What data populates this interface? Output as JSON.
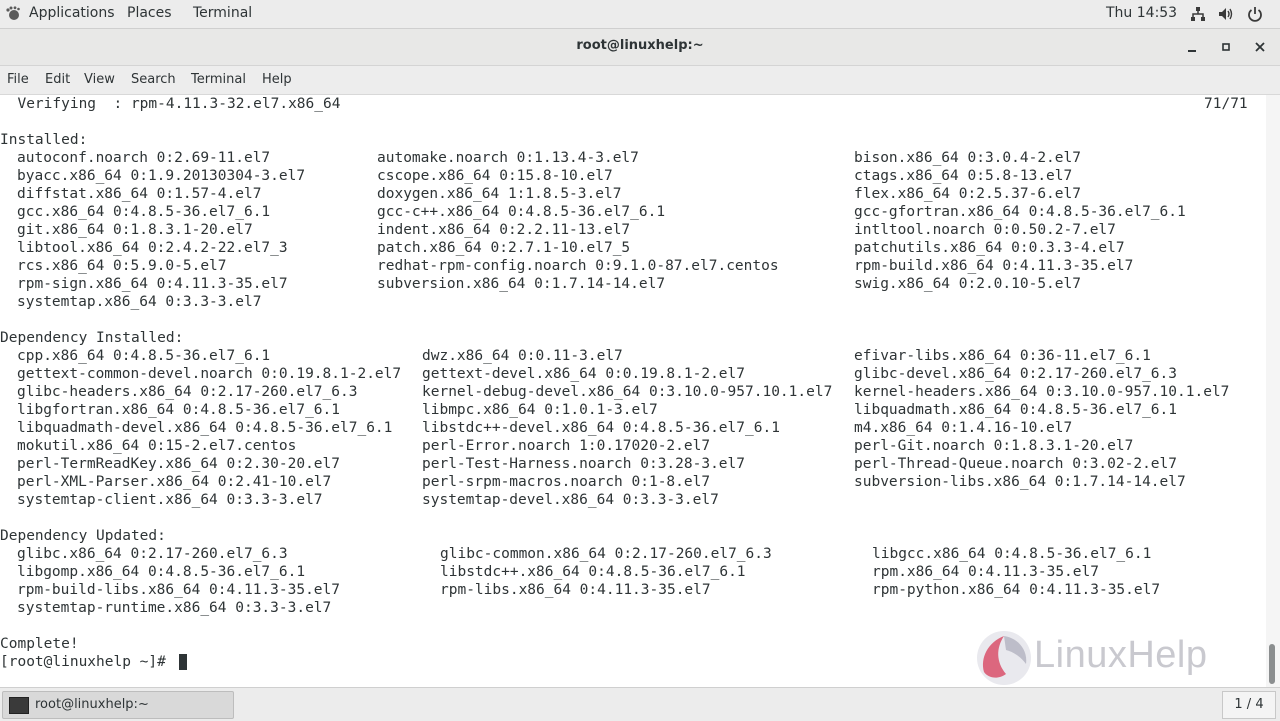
{
  "topbar": {
    "applications": "Applications",
    "places": "Places",
    "terminal": "Terminal",
    "clock": "Thu 14:53"
  },
  "window": {
    "title": "root@linuxhelp:~"
  },
  "menu": [
    "File",
    "Edit",
    "View",
    "Search",
    "Terminal",
    "Help"
  ],
  "terminal": {
    "verifying": "  Verifying  : rpm-4.11.3-32.el7.x86_64",
    "progress": "71/71",
    "installed_header": "Installed:",
    "installed": [
      [
        "autoconf.noarch 0:2.69-11.el7",
        "automake.noarch 0:1.13.4-3.el7",
        "bison.x86_64 0:3.0.4-2.el7"
      ],
      [
        "byacc.x86_64 0:1.9.20130304-3.el7",
        "cscope.x86_64 0:15.8-10.el7",
        "ctags.x86_64 0:5.8-13.el7"
      ],
      [
        "diffstat.x86_64 0:1.57-4.el7",
        "doxygen.x86_64 1:1.8.5-3.el7",
        "flex.x86_64 0:2.5.37-6.el7"
      ],
      [
        "gcc.x86_64 0:4.8.5-36.el7_6.1",
        "gcc-c++.x86_64 0:4.8.5-36.el7_6.1",
        "gcc-gfortran.x86_64 0:4.8.5-36.el7_6.1"
      ],
      [
        "git.x86_64 0:1.8.3.1-20.el7",
        "indent.x86_64 0:2.2.11-13.el7",
        "intltool.noarch 0:0.50.2-7.el7"
      ],
      [
        "libtool.x86_64 0:2.4.2-22.el7_3",
        "patch.x86_64 0:2.7.1-10.el7_5",
        "patchutils.x86_64 0:0.3.3-4.el7"
      ],
      [
        "rcs.x86_64 0:5.9.0-5.el7",
        "redhat-rpm-config.noarch 0:9.1.0-87.el7.centos",
        "rpm-build.x86_64 0:4.11.3-35.el7"
      ],
      [
        "rpm-sign.x86_64 0:4.11.3-35.el7",
        "subversion.x86_64 0:1.7.14-14.el7",
        "swig.x86_64 0:2.0.10-5.el7"
      ],
      [
        "systemtap.x86_64 0:3.3-3.el7",
        "",
        ""
      ]
    ],
    "dep_installed_header": "Dependency Installed:",
    "dep_installed": [
      [
        "cpp.x86_64 0:4.8.5-36.el7_6.1",
        "dwz.x86_64 0:0.11-3.el7",
        "efivar-libs.x86_64 0:36-11.el7_6.1"
      ],
      [
        "gettext-common-devel.noarch 0:0.19.8.1-2.el7",
        "gettext-devel.x86_64 0:0.19.8.1-2.el7",
        "glibc-devel.x86_64 0:2.17-260.el7_6.3"
      ],
      [
        "glibc-headers.x86_64 0:2.17-260.el7_6.3",
        "kernel-debug-devel.x86_64 0:3.10.0-957.10.1.el7",
        "kernel-headers.x86_64 0:3.10.0-957.10.1.el7"
      ],
      [
        "libgfortran.x86_64 0:4.8.5-36.el7_6.1",
        "libmpc.x86_64 0:1.0.1-3.el7",
        "libquadmath.x86_64 0:4.8.5-36.el7_6.1"
      ],
      [
        "libquadmath-devel.x86_64 0:4.8.5-36.el7_6.1",
        "libstdc++-devel.x86_64 0:4.8.5-36.el7_6.1",
        "m4.x86_64 0:1.4.16-10.el7"
      ],
      [
        "mokutil.x86_64 0:15-2.el7.centos",
        "perl-Error.noarch 1:0.17020-2.el7",
        "perl-Git.noarch 0:1.8.3.1-20.el7"
      ],
      [
        "perl-TermReadKey.x86_64 0:2.30-20.el7",
        "perl-Test-Harness.noarch 0:3.28-3.el7",
        "perl-Thread-Queue.noarch 0:3.02-2.el7"
      ],
      [
        "perl-XML-Parser.x86_64 0:2.41-10.el7",
        "perl-srpm-macros.noarch 0:1-8.el7",
        "subversion-libs.x86_64 0:1.7.14-14.el7"
      ],
      [
        "systemtap-client.x86_64 0:3.3-3.el7",
        "systemtap-devel.x86_64 0:3.3-3.el7",
        ""
      ]
    ],
    "dep_updated_header": "Dependency Updated:",
    "dep_updated": [
      [
        "glibc.x86_64 0:2.17-260.el7_6.3",
        "glibc-common.x86_64 0:2.17-260.el7_6.3",
        "libgcc.x86_64 0:4.8.5-36.el7_6.1"
      ],
      [
        "libgomp.x86_64 0:4.8.5-36.el7_6.1",
        "libstdc++.x86_64 0:4.8.5-36.el7_6.1",
        "rpm.x86_64 0:4.11.3-35.el7"
      ],
      [
        "rpm-build-libs.x86_64 0:4.11.3-35.el7",
        "rpm-libs.x86_64 0:4.11.3-35.el7",
        "rpm-python.x86_64 0:4.11.3-35.el7"
      ],
      [
        "systemtap-runtime.x86_64 0:3.3-3.el7",
        "",
        ""
      ]
    ],
    "complete": "Complete!",
    "prompt": "[root@linuxhelp ~]# "
  },
  "watermark": {
    "text": "LinuxHelp"
  },
  "taskbar": {
    "item_label": "root@linuxhelp:~",
    "workspace": "1 / 4"
  },
  "colors": {
    "text": "#2e3436",
    "panel": "#ececec",
    "watermark_red": "#d9506a"
  }
}
